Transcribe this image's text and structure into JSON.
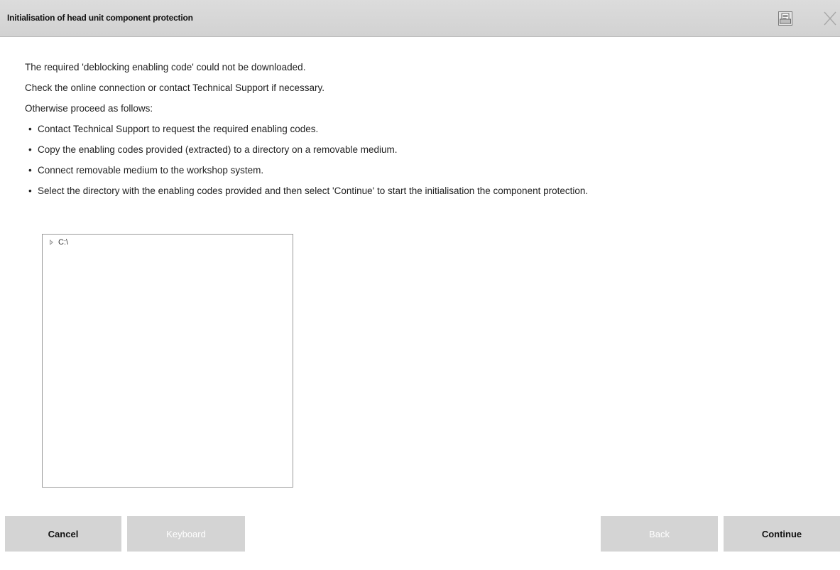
{
  "window": {
    "title": "Initialisation of head unit component protection",
    "print_icon": "printer-icon",
    "close_icon": "close-icon"
  },
  "message": {
    "lines": [
      "The required 'deblocking enabling code' could not be downloaded.",
      "Check the online connection or contact Technical Support if necessary.",
      "Otherwise proceed as follows:"
    ],
    "bullet_char": "•",
    "bullets": [
      "Contact Technical Support to request the required enabling codes.",
      "Copy the enabling codes provided (extracted) to a directory on a removable medium.",
      "Connect removable medium to the workshop system.",
      "Select the directory with the enabling codes provided and then select 'Continue' to start the initialisation the component protection."
    ]
  },
  "directory_tree": {
    "items": [
      {
        "label": "C:\\",
        "expanded": false,
        "icon": "expand-arrow-icon"
      }
    ]
  },
  "buttons": {
    "cancel": {
      "label": "Cancel",
      "enabled": true
    },
    "keyboard": {
      "label": "Keyboard",
      "enabled": false
    },
    "back": {
      "label": "Back",
      "enabled": false
    },
    "continue": {
      "label": "Continue",
      "enabled": true
    }
  },
  "colors": {
    "titlebar_bg": "#d6d6d6",
    "button_bg": "#d4d4d4",
    "disabled_text": "#ffffff",
    "tree_border": "#9a9a9a"
  }
}
